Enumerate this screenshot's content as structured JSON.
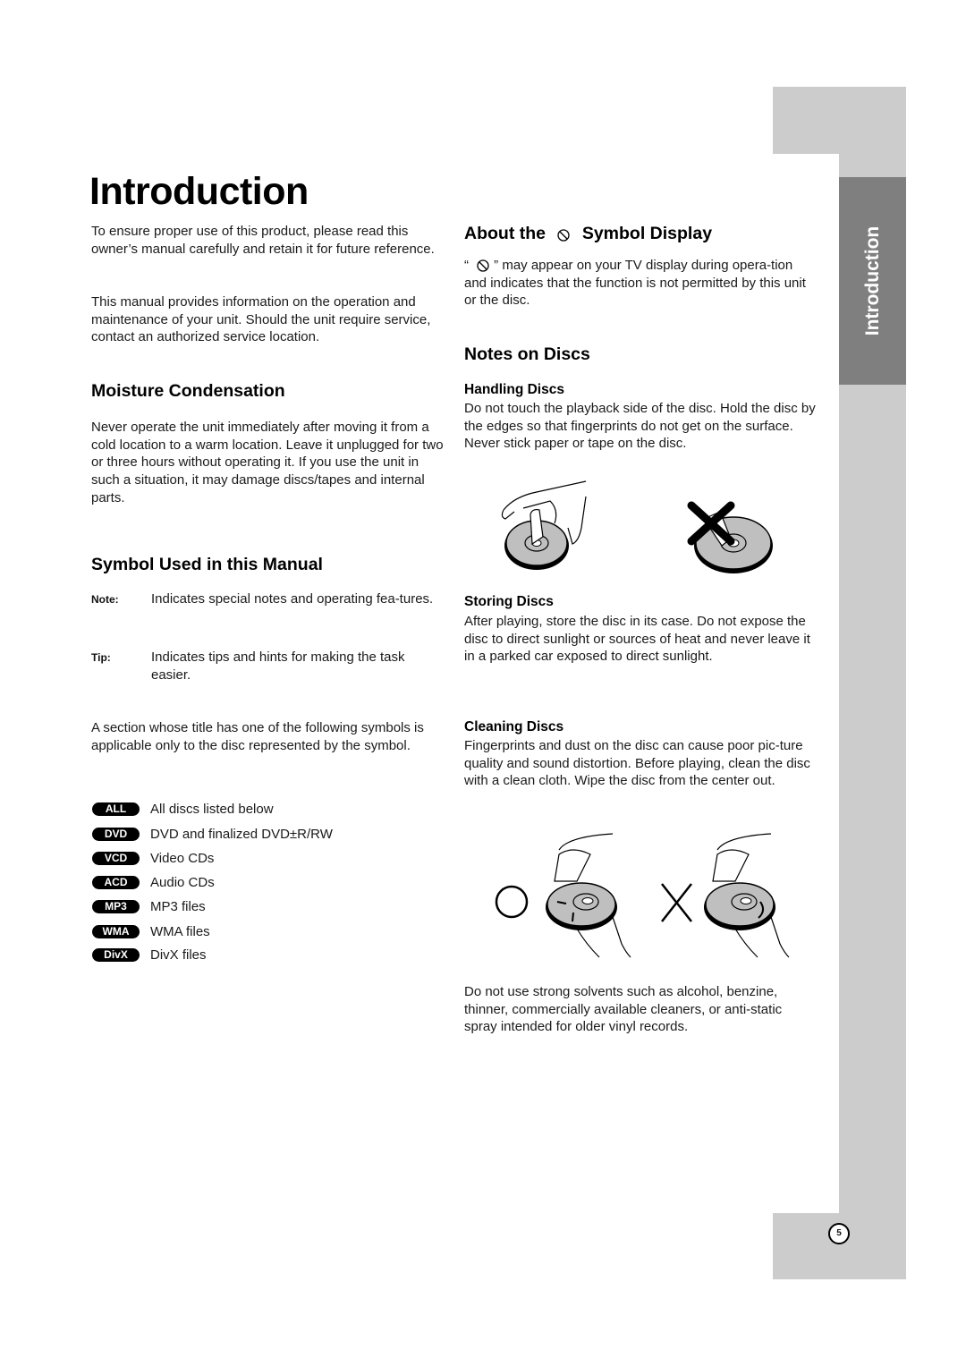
{
  "page": {
    "title": "Introduction",
    "side_tab_label": "Introduction",
    "page_number": "5",
    "colors": {
      "tab_light": "#cccccc",
      "tab_dark": "#7f7f7f",
      "badge": "#000000"
    }
  },
  "intro": {
    "p1": "To ensure proper use of this product, please read this owner’s manual carefully and retain it for future reference.",
    "p2": "This manual provides information on the operation and maintenance of your unit. Should the unit require service, contact an authorized service location."
  },
  "moisture": {
    "heading": "Moisture Condensation",
    "text": "Never operate the unit immediately after moving it from a cold location to a warm location. Leave it unplugged for two or three hours without operating it. If you use the unit in such a situation, it may damage discs/tapes and internal parts."
  },
  "symbols": {
    "heading": "Symbol Used in this Manual",
    "definitions": [
      {
        "term": "Note:",
        "desc": "Indicates special notes and operating fea-tures."
      },
      {
        "term": "Tip:",
        "desc": "Indicates tips and hints for making the task easier."
      }
    ],
    "section_text": "A section whose title has one of the following symbols is applicable only to the disc represented by the symbol.",
    "discs": [
      {
        "badge": "ALL",
        "desc": "All discs listed below"
      },
      {
        "badge": "DVD",
        "desc": "DVD and finalized DVD±R/RW"
      },
      {
        "badge": "VCD",
        "desc": "Video CDs"
      },
      {
        "badge": "ACD",
        "desc": "Audio CDs"
      },
      {
        "badge": "MP3",
        "desc": "MP3 files"
      },
      {
        "badge": "WMA",
        "desc": "WMA files"
      },
      {
        "badge": "DivX",
        "desc": "DivX files"
      }
    ]
  },
  "about_symbol": {
    "heading_pre": "About the",
    "heading_post": "Symbol Display",
    "icon": "prohibited-icon",
    "quote_open": "“",
    "text_after_icon": "” may appear on your TV display during opera-tion and indicates that the function is not permitted by this unit or the disc."
  },
  "notes_on_discs": {
    "heading": "Notes on Discs",
    "handling": {
      "heading": "Handling Discs",
      "text": "Do not touch the playback side of the disc. Hold the disc by the edges so that fingerprints do not get on the surface. Never stick paper or tape on the disc."
    },
    "storing": {
      "heading": "Storing Discs",
      "text": "After playing, store the disc in its case. Do not expose the disc to direct sunlight or sources of heat and never leave it in a parked car exposed to direct sunlight."
    },
    "cleaning": {
      "heading": "Cleaning Discs",
      "text": "Fingerprints and dust on the disc can cause poor pic-ture quality and sound distortion. Before playing, clean the disc with a clean cloth. Wipe the disc from the center out.",
      "warning": "Do not use strong solvents such as alcohol, benzine, thinner, commercially available cleaners, or anti-static spray intended for older vinyl records."
    }
  }
}
